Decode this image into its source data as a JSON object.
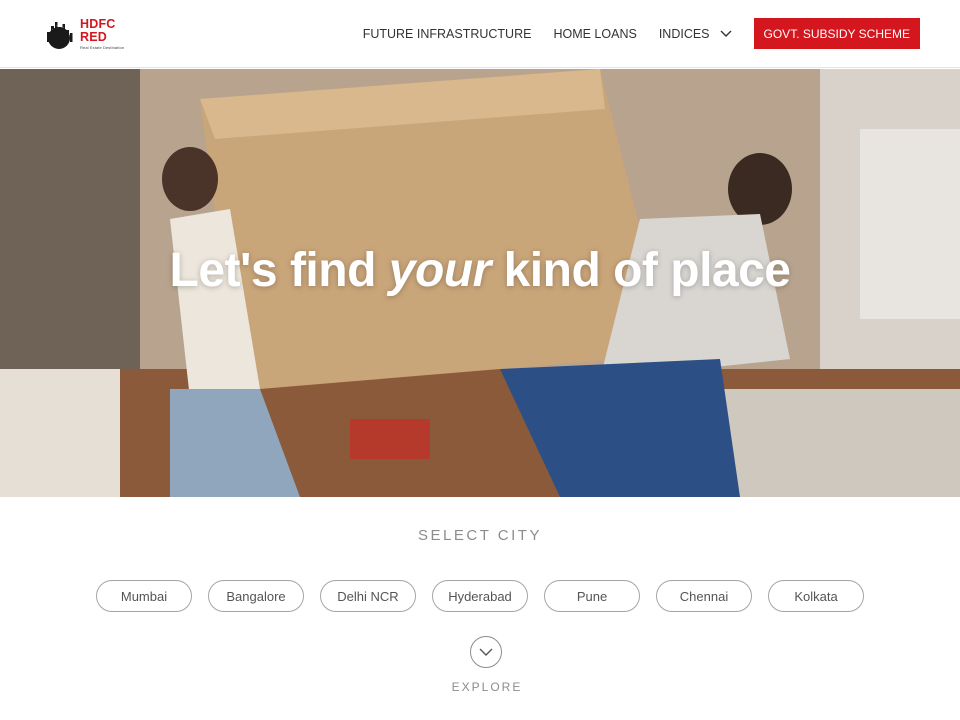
{
  "header": {
    "logo": {
      "line1": "HDFC",
      "line2": "RED",
      "tagline": "Real Estate Destination",
      "icon": "city-skyline-icon",
      "color": "#d4161e"
    },
    "nav": [
      {
        "label": "FUTURE INFRASTRUCTURE"
      },
      {
        "label": "HOME LOANS"
      },
      {
        "label": "INDICES",
        "icon": "chevron-down-icon"
      }
    ],
    "cta_label": "GOVT. SUBSIDY SCHEME",
    "cta_color": "#d4161e"
  },
  "hero": {
    "title_before": "Let's find ",
    "title_emphasis": "your",
    "title_after": " kind of place"
  },
  "city_select": {
    "title": "SELECT CITY",
    "cities": [
      "Mumbai",
      "Bangalore",
      "Delhi NCR",
      "Hyderabad",
      "Pune",
      "Chennai",
      "Kolkata"
    ],
    "explore_icon": "chevron-down-icon",
    "explore_label": "EXPLORE"
  }
}
